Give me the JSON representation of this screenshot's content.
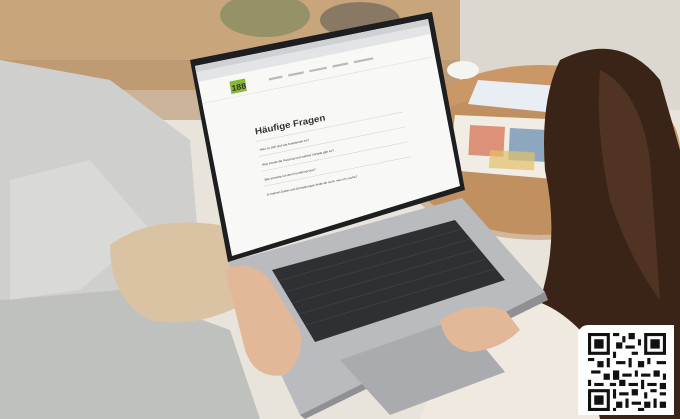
{
  "website": {
    "logo_text": "188",
    "faq_heading": "Häufige Fragen",
    "faq_items": [
      "Was ist 188 und wie funktioniert es?",
      "Was kostet die Nutzung und welche Vorteile gibt es?",
      "Wie erreiche ich den Kundenservice?",
      "In meinen Daten und Einstellungen finde ich nicht, was ich suche?"
    ]
  },
  "colors": {
    "logo_green": "#86b833",
    "logo_yellow": "#e6c31e",
    "screen_bg": "#f8f8f6",
    "laptop_body": "#b9bbbe",
    "keyboard": "#2f3033",
    "wall": "#e8e3da",
    "floor_wood": "#c9a57c",
    "sofa": "#c8c9c7",
    "hair": "#3a2418"
  },
  "icons": [
    "qr-code-icon"
  ]
}
